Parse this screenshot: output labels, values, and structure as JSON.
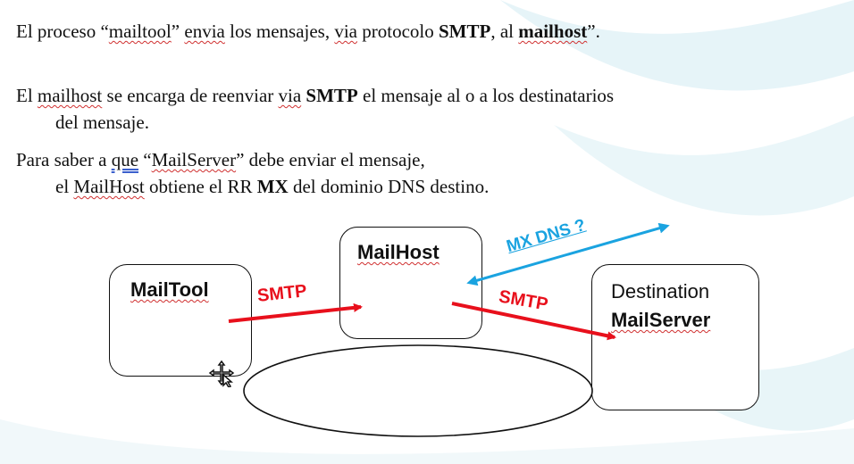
{
  "slide": {
    "line1": {
      "p1": "El proceso “",
      "mailtool": "mailtool",
      "p2": "” ",
      "envia": "envia",
      "p3": " los mensajes, ",
      "via": "via",
      "p4": " protocolo ",
      "smtp": "SMTP",
      "p5": ", al ",
      "mailhost": "mailhost",
      "p6": "”."
    },
    "line2": {
      "p1": "El ",
      "mailhost": "mailhost",
      "p2": " se encarga de reenviar ",
      "via": "via",
      "p3": " ",
      "smtp": "SMTP",
      "p4": " el mensaje al o a los destinatarios"
    },
    "line3": "del mensaje.",
    "line4": {
      "p1": "Para saber a ",
      "que": "que",
      "p2": " “",
      "mailserver": "MailServer",
      "p3": "” debe enviar el mensaje,"
    },
    "line5": {
      "p1": "el ",
      "mailhost": "MailHost",
      "p2": " obtiene el RR ",
      "mx": "MX",
      "p3": " del dominio DNS destino."
    }
  },
  "diagram": {
    "nodes": {
      "mailtool": "MailTool",
      "mailhost": "MailHost",
      "destination_line1": "Destination",
      "destination_line2": "MailServer"
    },
    "edges": {
      "smtp_1": "SMTP",
      "smtp_2": "SMTP",
      "mx_dns": "MX DNS ?"
    }
  },
  "colors": {
    "smtp_arrow": "#e8101c",
    "mx_dns_arrow": "#1aa3e0",
    "swoosh": "#e6f4f8"
  },
  "icons": {
    "cursor": "move-cursor-icon"
  }
}
